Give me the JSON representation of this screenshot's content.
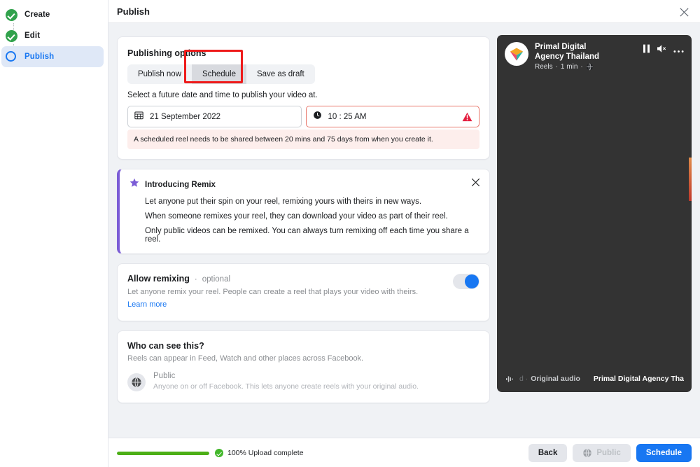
{
  "sidebar": {
    "steps": [
      {
        "label": "Create",
        "state": "done",
        "icon": "check-circle-icon"
      },
      {
        "label": "Edit",
        "state": "done",
        "icon": "check-circle-icon"
      },
      {
        "label": "Publish",
        "state": "current",
        "icon": "empty-circle-icon"
      }
    ]
  },
  "header": {
    "title": "Publish",
    "close_icon": "close-icon"
  },
  "publishing_options": {
    "title": "Publishing options",
    "tabs": [
      {
        "label": "Publish now",
        "selected": false
      },
      {
        "label": "Schedule",
        "selected": true
      },
      {
        "label": "Save as draft",
        "selected": false
      }
    ],
    "help_text": "Select a future date and time to publish your video at.",
    "date_field": {
      "icon": "calendar-icon",
      "value": "21 September 2022",
      "error": false
    },
    "time_field": {
      "icon": "clock-icon",
      "value": "10 : 25 AM",
      "error": true,
      "error_icon": "warning-triangle-icon"
    },
    "error_message": "A scheduled reel needs to be shared between 20 mins and 75 days from when you create it."
  },
  "remix_announcement": {
    "icon": "star-icon",
    "title": "Introducing Remix",
    "close_icon": "close-icon",
    "lines": [
      "Let anyone put their spin on your reel, remixing yours with theirs in new ways.",
      "When someone remixes your reel, they can download your video as part of their reel.",
      "Only public videos can be remixed. You can always turn remixing off each time you share a reel."
    ]
  },
  "allow_remixing": {
    "title": "Allow remixing",
    "separator": "·",
    "optional_label": "optional",
    "description": "Let anyone remix your reel. People can create a reel that plays your video with theirs.",
    "learn_more": "Learn more",
    "toggle_on": true
  },
  "who_can_see": {
    "title": "Who can see this?",
    "subtitle": "Reels can appear in Feed, Watch and other places across Facebook.",
    "audience": {
      "icon": "globe-icon",
      "name": "Public",
      "description": "Anyone on or off Facebook. This lets anyone create reels with your original audio."
    }
  },
  "preview": {
    "avatar_icon": "brand-prism-avatar",
    "page_name": "Primal Digital Agency Thailand",
    "meta_type": "Reels",
    "meta_sep1": "·",
    "meta_duration": "1 min",
    "meta_sep2": "·",
    "meta_privacy_icon": "globe-icon",
    "controls": [
      {
        "icon": "pause-icon"
      },
      {
        "icon": "speaker-muted-icon"
      },
      {
        "icon": "more-horizontal-icon"
      }
    ],
    "audio_icon": "audio-waveform-icon",
    "audio_prefix": "d ·",
    "audio_label": "Original audio",
    "audio_author": "Primal Digital Agency Tha"
  },
  "bottom_bar": {
    "progress_percent": 100,
    "progress_icon": "check-circle-icon",
    "progress_text": "100% Upload complete",
    "buttons": {
      "back": "Back",
      "audience": "Public",
      "audience_icon": "globe-icon",
      "primary": "Schedule"
    }
  },
  "annotation": {
    "highlight_color": "#ee1b1b",
    "highlight_target": "Schedule"
  },
  "colors": {
    "accent_blue": "#1877f2",
    "success_green": "#42b72a",
    "error_red": "#e41e3f",
    "remix_purple": "#7b5cd6",
    "page_bg": "#f0f2f5"
  }
}
